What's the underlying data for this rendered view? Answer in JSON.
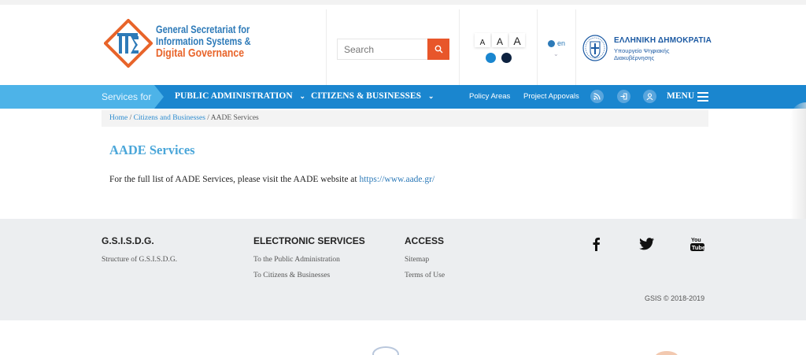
{
  "header": {
    "logo": {
      "line1": "General Secretariat for",
      "line2": "Information Systems &",
      "line3": "Digital Governance"
    },
    "search": {
      "placeholder": "Search"
    },
    "font_sizes": [
      "A",
      "A",
      "A"
    ],
    "contrast_colors": [
      "#1a86cf",
      "#0d2240"
    ],
    "language": "en",
    "gov": {
      "title": "ΕΛΛΗΝΙΚΗ ΔΗΜΟΚΡΑΤΙΑ",
      "subtitle_line1": "Υπουργείο Ψηφιακής",
      "subtitle_line2": "Διακυβέρνησης"
    }
  },
  "nav": {
    "services_for": "Services for",
    "public_admin": "PUBLIC ADMINISTRATION",
    "citizens": "CITIZENS & BUSINESSES",
    "policy_areas": "Policy Areas",
    "project_approvals": "Project Appovals",
    "menu": "MENU"
  },
  "breadcrumb": {
    "home": "Home",
    "section": "Citizens and Businesses",
    "current": "AADE Services",
    "sep": "/"
  },
  "main": {
    "title": "AADE Services",
    "text": "For the full list of AADE Services, please visit the AADE website at ",
    "link": "https://www.aade.gr/"
  },
  "footer": {
    "col1": {
      "heading": "G.S.I.S.D.G.",
      "links": [
        "Structure of G.S.I.S.D.G."
      ]
    },
    "col2": {
      "heading": "ELECTRONIC SERVICES",
      "links": [
        "To the Public Administration",
        "To Citizens & Businesses"
      ]
    },
    "col3": {
      "heading": "ACCESS",
      "links": [
        "Sitemap",
        "Terms of Use"
      ]
    },
    "social": [
      "facebook-icon",
      "twitter-icon",
      "youtube-icon"
    ],
    "copyright": "GSIS © 2018-2019"
  },
  "colors": {
    "nav_blue": "#1a86cf",
    "services_light_blue": "#4db3e8",
    "accent_orange": "#e8562a",
    "title_blue": "#4aa6d9"
  }
}
